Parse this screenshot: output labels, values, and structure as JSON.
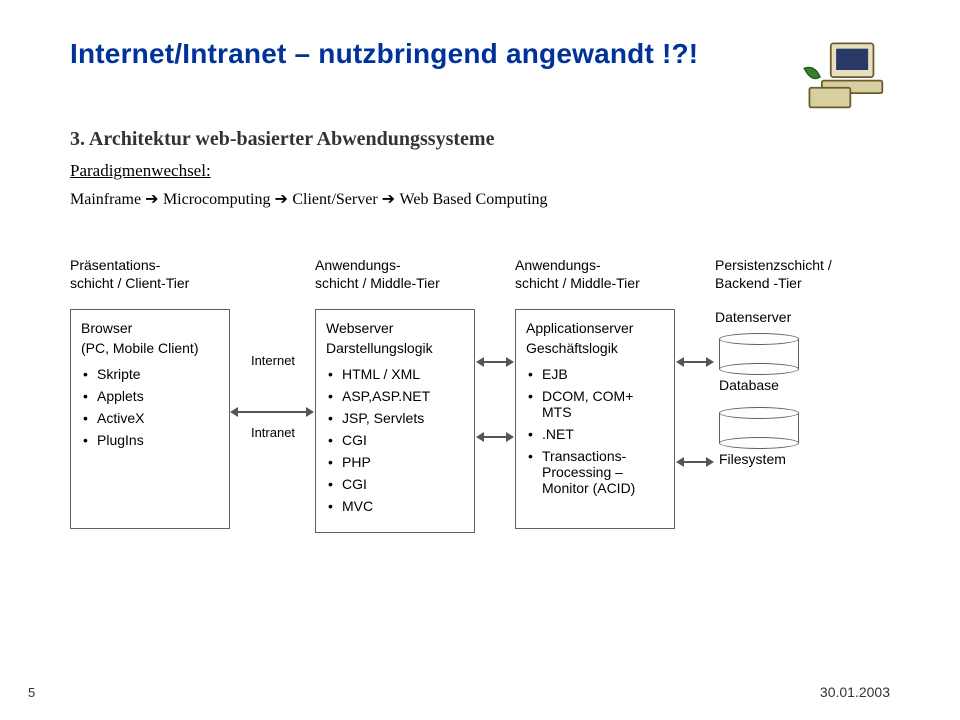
{
  "header": {
    "title": "Internet/Intranet – nutzbringend angewandt !?!"
  },
  "section": {
    "heading": "3. Architektur web-basierter Abwendungssysteme",
    "subheading": "Paradigmenwechsel:",
    "paradigm_1": "Mainframe",
    "paradigm_2": "Microcomputing",
    "paradigm_3": "Client/Server",
    "paradigm_4": "Web Based Computing"
  },
  "net": {
    "internet": "Internet",
    "intranet": "Intranet"
  },
  "tiers": {
    "col1": {
      "caption": "Präsentations-\nschicht / Client-Tier",
      "box_title": "Browser",
      "box_sub": "(PC, Mobile Client)",
      "items": [
        "Skripte",
        "Applets",
        "ActiveX",
        "PlugIns"
      ]
    },
    "col2": {
      "caption": "Anwendungs-\nschicht / Middle-Tier",
      "box_title": "Webserver",
      "box_sub": "Darstellungslogik",
      "items": [
        "HTML / XML",
        "ASP,ASP.NET",
        "JSP, Servlets",
        "CGI",
        "PHP",
        "CGI",
        "MVC"
      ]
    },
    "col3": {
      "caption": "Anwendungs-\nschicht / Middle-Tier",
      "box_title": "Applicationserver",
      "box_sub": "Geschäftslogik",
      "items": [
        "EJB",
        "DCOM, COM+ MTS",
        ".NET",
        "Transactions-Processing – Monitor (ACID)"
      ]
    },
    "col4": {
      "caption": "Persistenzschicht / Backend -Tier",
      "server": "Datenserver",
      "db_label": "Database",
      "fs_label": "Filesystem"
    }
  },
  "footer": {
    "page": "5",
    "date": "30.01.2003"
  }
}
